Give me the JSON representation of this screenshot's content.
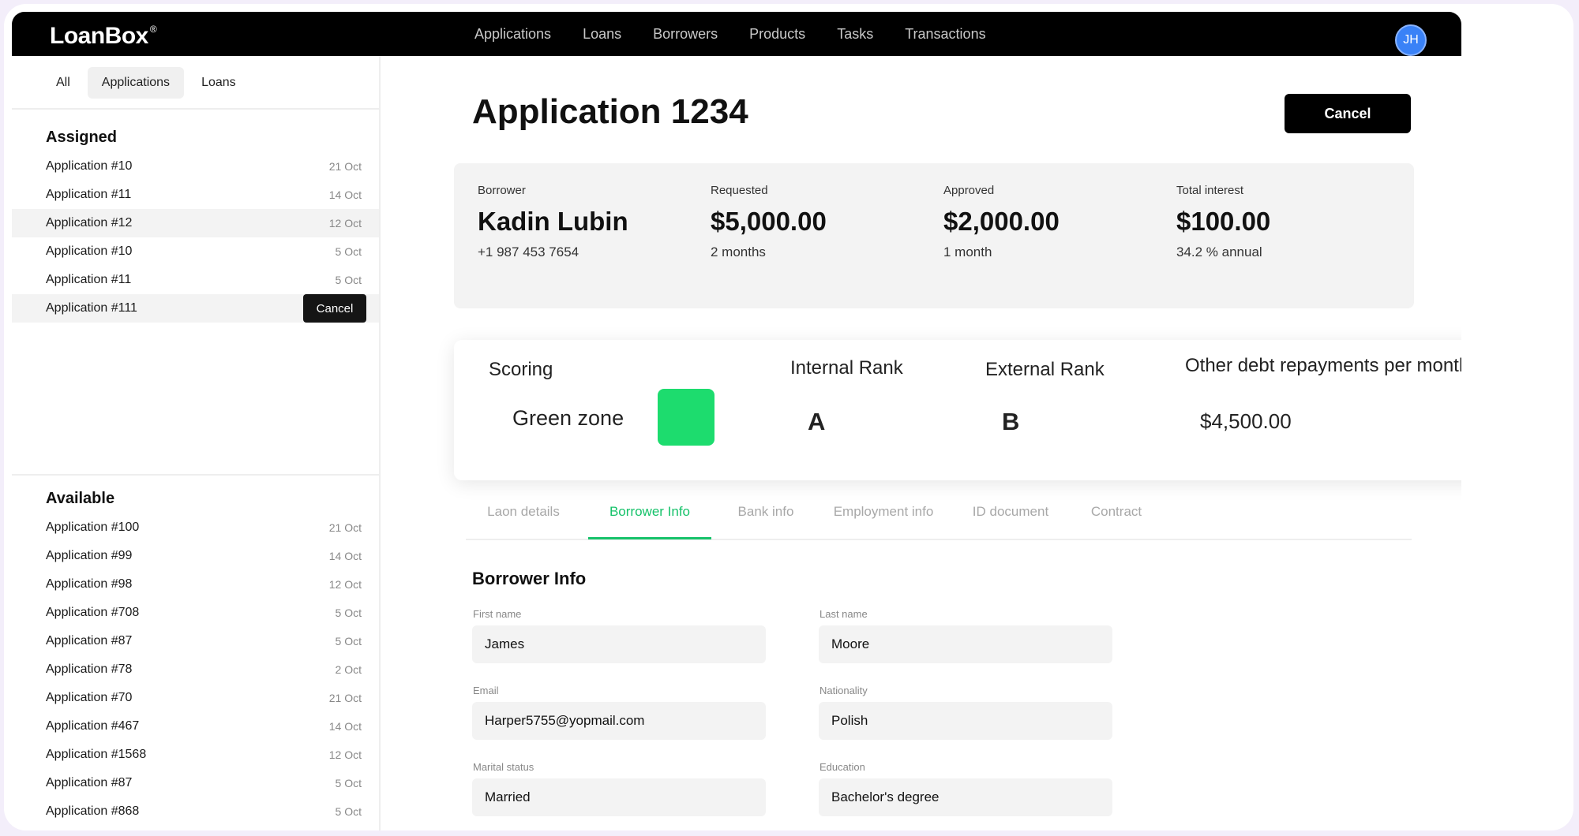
{
  "app": {
    "logo": "LoanBox",
    "logo_mark": "®",
    "nav": [
      "Applications",
      "Loans",
      "Borrowers",
      "Products",
      "Tasks",
      "Transactions"
    ],
    "avatar_initials": "JH"
  },
  "sidebar": {
    "tabs": [
      "All",
      "Applications",
      "Loans"
    ],
    "active_tab": "Applications",
    "assigned_title": "Assigned",
    "assigned": [
      {
        "name": "Application #10",
        "date": "21 Oct"
      },
      {
        "name": "Application #11",
        "date": "14 Oct"
      },
      {
        "name": "Application #12",
        "date": "12 Oct"
      },
      {
        "name": "Application #10",
        "date": "5 Oct"
      },
      {
        "name": "Application #11",
        "date": "5 Oct"
      },
      {
        "name": "Application #111",
        "action": "Cancel"
      }
    ],
    "available_title": "Available",
    "available": [
      {
        "name": "Application #100",
        "date": "21 Oct"
      },
      {
        "name": "Application #99",
        "date": "14 Oct"
      },
      {
        "name": "Application #98",
        "date": "12 Oct"
      },
      {
        "name": "Application #708",
        "date": "5 Oct"
      },
      {
        "name": "Application #87",
        "date": "5 Oct"
      },
      {
        "name": "Application #78",
        "date": "2 Oct"
      },
      {
        "name": "Application #70",
        "date": "21 Oct"
      },
      {
        "name": "Application #467",
        "date": "14 Oct"
      },
      {
        "name": "Application #1568",
        "date": "12 Oct"
      },
      {
        "name": "Application #87",
        "date": "5 Oct"
      },
      {
        "name": "Application #868",
        "date": "5 Oct"
      }
    ]
  },
  "main": {
    "title": "Application 1234",
    "cancel_label": "Cancel",
    "summary": {
      "borrower": {
        "label": "Borrower",
        "value": "Kadin Lubin",
        "sub": "+1 987 453 7654"
      },
      "requested": {
        "label": "Requested",
        "value": "$5,000.00",
        "sub": "2 months"
      },
      "approved": {
        "label": "Approved",
        "value": "$2,000.00",
        "sub": "1 month"
      },
      "interest": {
        "label": "Total interest",
        "value": "$100.00",
        "sub": "34.2 % annual"
      }
    },
    "scoring": {
      "label": "Scoring",
      "zone": "Green zone",
      "zone_color": "#1ddc6e",
      "internal_rank_label": "Internal Rank",
      "internal_rank": "A",
      "external_rank_label": "External Rank",
      "external_rank": "B",
      "debt_label": "Other debt repayments per month",
      "debt_value": "$4,500.00"
    },
    "tabs": [
      "Laon details",
      "Borrower Info",
      "Bank info",
      "Employment info",
      "ID document",
      "Contract"
    ],
    "active_tab": "Borrower Info",
    "accent_color": "#16c26a",
    "form": {
      "title": "Borrower Info",
      "first_name": {
        "label": "First name",
        "value": "James"
      },
      "last_name": {
        "label": "Last name",
        "value": "Moore"
      },
      "email": {
        "label": "Email",
        "value": "Harper5755@yopmail.com"
      },
      "nationality": {
        "label": "Nationality",
        "value": "Polish"
      },
      "marital_status": {
        "label": "Marital status",
        "value": "Married"
      },
      "education": {
        "label": "Education",
        "value": "Bachelor's degree"
      }
    }
  }
}
